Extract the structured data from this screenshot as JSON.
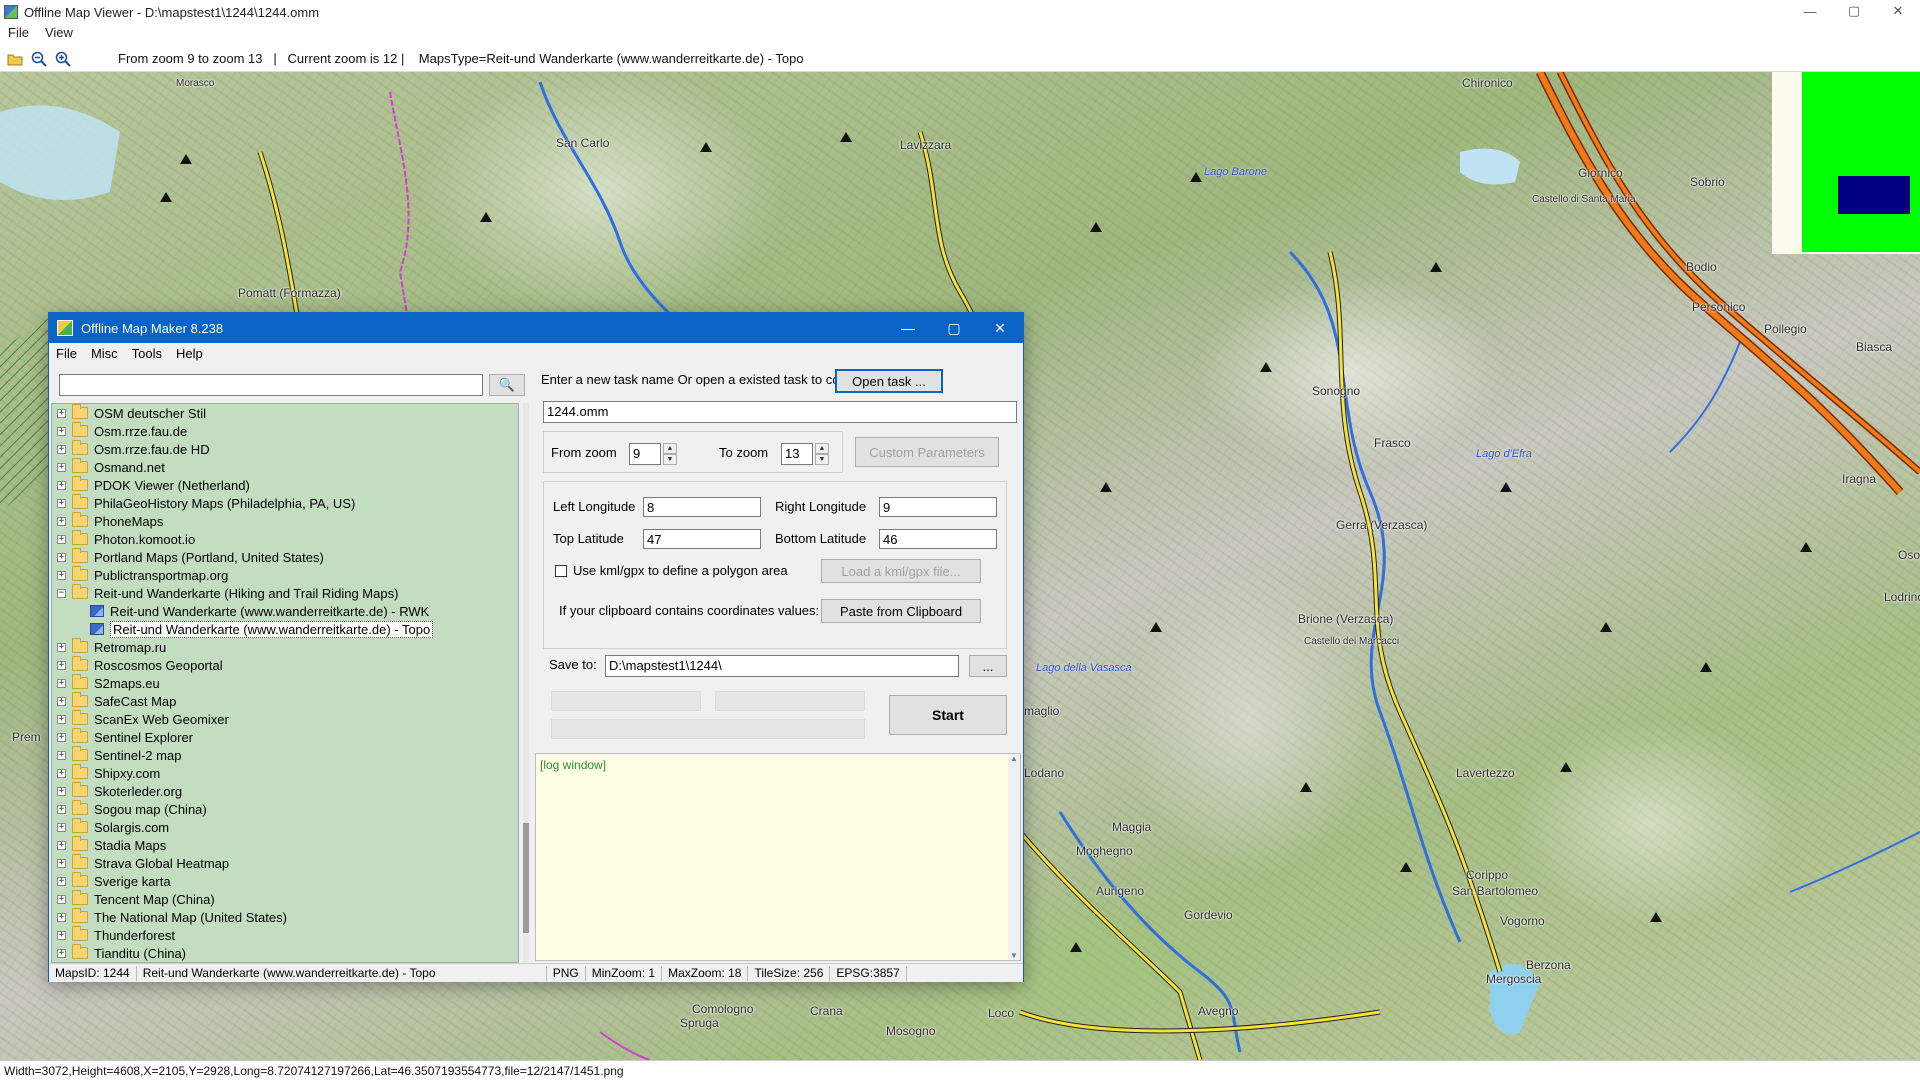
{
  "viewer": {
    "title": "Offline Map Viewer - D:\\mapstest1\\1244\\1244.omm",
    "menu": [
      "File",
      "View"
    ],
    "toolbar_info": "From zoom 9 to zoom 13   |   Current zoom is 12 |    MapsType=Reit-und Wanderkarte (www.wanderreitkarte.de) - Topo",
    "status": "Width=3072,Height=4608,X=2105,Y=2928,Long=8.72074127197266,Lat=46.3507193554773,file=12/2147/1451.png",
    "controls": {
      "minimize": "—",
      "maximize": "▢",
      "close": "✕"
    }
  },
  "map": {
    "places": [
      {
        "name": "Chironico",
        "cls": ""
      },
      {
        "name": "Lavizzara",
        "cls": ""
      },
      {
        "name": "San Carlo",
        "cls": ""
      },
      {
        "name": "Pomatt (Formazza)",
        "cls": ""
      },
      {
        "name": "Giornico",
        "cls": ""
      },
      {
        "name": "Sobrio",
        "cls": ""
      },
      {
        "name": "Castello di Santa Maria",
        "cls": "small"
      },
      {
        "name": "Bodio",
        "cls": ""
      },
      {
        "name": "Personico",
        "cls": ""
      },
      {
        "name": "Pollegio",
        "cls": ""
      },
      {
        "name": "Biasca",
        "cls": ""
      },
      {
        "name": "Sonogno",
        "cls": ""
      },
      {
        "name": "Frasco",
        "cls": ""
      },
      {
        "name": "Iragna",
        "cls": ""
      },
      {
        "name": "Gerra (Verzasca)",
        "cls": ""
      },
      {
        "name": "Brione (Verzasca)",
        "cls": ""
      },
      {
        "name": "Castello dei Marcacci",
        "cls": "small"
      },
      {
        "name": "Lavertezzo",
        "cls": ""
      },
      {
        "name": "Maggia",
        "cls": ""
      },
      {
        "name": "Moghegno",
        "cls": ""
      },
      {
        "name": "Aurigeno",
        "cls": ""
      },
      {
        "name": "Gordevio",
        "cls": ""
      },
      {
        "name": "Corippo",
        "cls": ""
      },
      {
        "name": "San Bartolomeo",
        "cls": ""
      },
      {
        "name": "Vogorno",
        "cls": ""
      },
      {
        "name": "Berzona",
        "cls": ""
      },
      {
        "name": "Mergoscia",
        "cls": ""
      },
      {
        "name": "Avegno",
        "cls": ""
      },
      {
        "name": "Comologno",
        "cls": ""
      },
      {
        "name": "Spruga",
        "cls": ""
      },
      {
        "name": "Crana",
        "cls": ""
      },
      {
        "name": "Mosogno",
        "cls": ""
      },
      {
        "name": "Loco",
        "cls": ""
      },
      {
        "name": "maglio",
        "cls": ""
      },
      {
        "name": "Lodano",
        "cls": ""
      },
      {
        "name": "Lodrino",
        "cls": ""
      },
      {
        "name": "Osogna",
        "cls": ""
      },
      {
        "name": "Prem",
        "cls": ""
      },
      {
        "name": "Morasco",
        "cls": ""
      }
    ],
    "lakes": [
      "Lago Barone",
      "Lago d'Efra",
      "Lago della Vasasca"
    ],
    "overview_colors": {
      "background": "#fdfaee",
      "area": "#00ff00",
      "viewport": "#000080"
    }
  },
  "dialog": {
    "title": "Offline Map Maker 8.238",
    "menu": [
      "File",
      "Misc",
      "Tools",
      "Help"
    ],
    "search_placeholder": "",
    "search_icon": "🔍",
    "tree": [
      {
        "label": "OSM deutscher Stil",
        "type": "folder",
        "exp": "+"
      },
      {
        "label": "Osm.rrze.fau.de",
        "type": "folder",
        "exp": "+"
      },
      {
        "label": "Osm.rrze.fau.de HD",
        "type": "folder",
        "exp": "+"
      },
      {
        "label": "Osmand.net",
        "type": "folder",
        "exp": "+"
      },
      {
        "label": "PDOK Viewer (Netherland)",
        "type": "folder",
        "exp": "+"
      },
      {
        "label": "PhilaGeoHistory Maps (Philadelphia, PA, US)",
        "type": "folder",
        "exp": "+"
      },
      {
        "label": "PhoneMaps",
        "type": "folder",
        "exp": "+"
      },
      {
        "label": "Photon.komoot.io",
        "type": "folder",
        "exp": "+"
      },
      {
        "label": "Portland Maps (Portland, United States)",
        "type": "folder",
        "exp": "+"
      },
      {
        "label": "Publictransportmap.org",
        "type": "folder",
        "exp": "+"
      },
      {
        "label": "Reit-und Wanderkarte (Hiking and Trail Riding Maps)",
        "type": "folder",
        "exp": "−"
      },
      {
        "label": "Reit-und Wanderkarte (www.wanderreitkarte.de) - RWK",
        "type": "map"
      },
      {
        "label": "Reit-und Wanderkarte (www.wanderreitkarte.de) - Topo",
        "type": "map-selected"
      },
      {
        "label": "Retromap.ru",
        "type": "folder",
        "exp": "+"
      },
      {
        "label": "Roscosmos Geoportal",
        "type": "folder",
        "exp": "+"
      },
      {
        "label": "S2maps.eu",
        "type": "folder",
        "exp": "+"
      },
      {
        "label": "SafeCast Map",
        "type": "folder",
        "exp": "+"
      },
      {
        "label": "ScanEx Web Geomixer",
        "type": "folder",
        "exp": "+"
      },
      {
        "label": "Sentinel Explorer",
        "type": "folder",
        "exp": "+"
      },
      {
        "label": "Sentinel-2 map",
        "type": "folder",
        "exp": "+"
      },
      {
        "label": "Shipxy.com",
        "type": "folder",
        "exp": "+"
      },
      {
        "label": "Skoterleder.org",
        "type": "folder",
        "exp": "+"
      },
      {
        "label": "Sogou map (China)",
        "type": "folder",
        "exp": "+"
      },
      {
        "label": "Solargis.com",
        "type": "folder",
        "exp": "+"
      },
      {
        "label": "Stadia Maps",
        "type": "folder",
        "exp": "+"
      },
      {
        "label": "Strava Global Heatmap",
        "type": "folder",
        "exp": "+"
      },
      {
        "label": "Sverige karta",
        "type": "folder",
        "exp": "+"
      },
      {
        "label": "Tencent Map (China)",
        "type": "folder",
        "exp": "+"
      },
      {
        "label": "The National Map (United States)",
        "type": "folder",
        "exp": "+"
      },
      {
        "label": "Thunderforest",
        "type": "folder",
        "exp": "+"
      },
      {
        "label": "Tianditu (China)",
        "type": "folder",
        "exp": "+"
      }
    ],
    "task_prompt": "Enter a new task name Or open a existed task to continue:",
    "open_task_label": "Open task ...",
    "task_name": "1244.omm",
    "from_zoom_label": "From zoom",
    "from_zoom": "9",
    "to_zoom_label": "To zoom",
    "to_zoom": "13",
    "custom_params_label": "Custom Parameters",
    "left_lon_label": "Left Longitude",
    "left_lon": "8",
    "right_lon_label": "Right Longitude",
    "right_lon": "9",
    "top_lat_label": "Top Latitude",
    "top_lat": "47",
    "bottom_lat_label": "Bottom Latitude",
    "bottom_lat": "46",
    "kml_label": "Use kml/gpx to define a polygon area",
    "load_kml_label": "Load a kml/gpx file...",
    "clipboard_prompt": "If your clipboard contains coordinates values:",
    "paste_label": "Paste from Clipboard",
    "save_to_label": "Save to:",
    "save_to": "D:\\mapstest1\\1244\\",
    "browse_label": "...",
    "start_label": "Start",
    "log_text": "[log window]",
    "status": {
      "maps_id": "MapsID: 1244",
      "maps_name": "Reit-und Wanderkarte (www.wanderreitkarte.de) - Topo",
      "format": "PNG",
      "min_zoom": "MinZoom: 1",
      "max_zoom": "MaxZoom: 18",
      "tile_size": "TileSize: 256",
      "epsg": "EPSG:3857"
    }
  }
}
